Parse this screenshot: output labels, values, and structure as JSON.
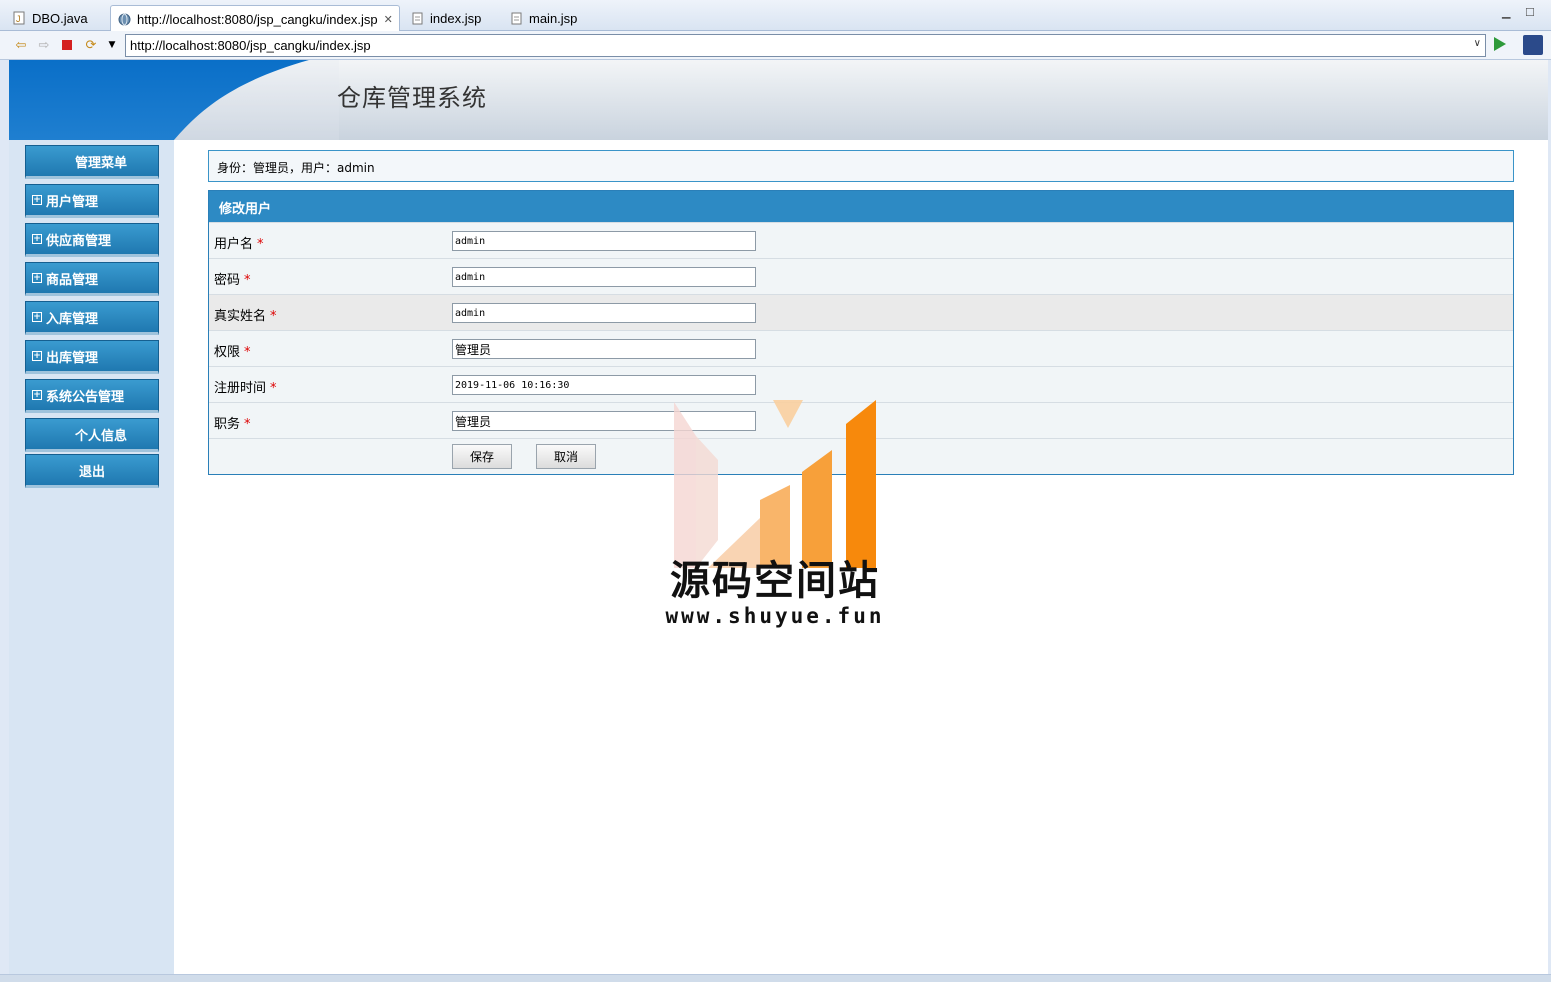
{
  "tabs": [
    {
      "label": "DBO.java",
      "icon": "java-file-icon"
    },
    {
      "label": "http://localhost:8080/jsp_cangku/index.jsp",
      "icon": "globe-icon",
      "active": true
    },
    {
      "label": "index.jsp",
      "icon": "jsp-file-icon"
    },
    {
      "label": "main.jsp",
      "icon": "jsp-file-icon"
    }
  ],
  "browser": {
    "url": "http://localhost:8080/jsp_cangku/index.jsp"
  },
  "banner": {
    "title": "仓库管理系统"
  },
  "sidebar": {
    "header": "管理菜单",
    "items": [
      {
        "label": "用户管理"
      },
      {
        "label": "供应商管理"
      },
      {
        "label": "商品管理"
      },
      {
        "label": "入库管理"
      },
      {
        "label": "出库管理"
      },
      {
        "label": "系统公告管理"
      }
    ],
    "profile": "个人信息",
    "logout": "退出"
  },
  "userinfo": "身份：管理员，用户：admin",
  "form": {
    "title": "修改用户",
    "fields": [
      {
        "label": "用户名",
        "value": "admin"
      },
      {
        "label": "密码",
        "value": "admin"
      },
      {
        "label": "真实姓名",
        "value": "admin"
      },
      {
        "label": "权限",
        "value": "管理员"
      },
      {
        "label": "注册时间",
        "value": "2019-11-06 10:16:30"
      },
      {
        "label": "职务",
        "value": "管理员"
      }
    ],
    "required_mark": "*",
    "save": "保存",
    "cancel": "取消"
  },
  "watermark": {
    "title": "源码空间站",
    "url": "www.shuyue.fun"
  },
  "colors": {
    "menu_blue": "#2d8ac4",
    "banner_blue": "#0a6fc8",
    "watermark_orange": "#f7890c"
  }
}
